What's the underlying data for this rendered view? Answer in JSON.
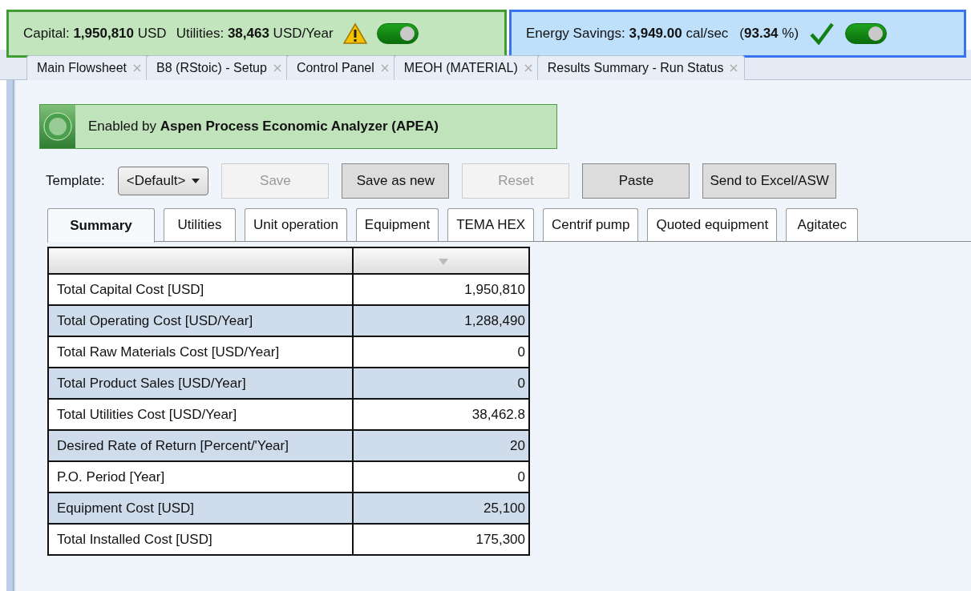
{
  "status_panels": [
    {
      "kind": "cost",
      "texts": [
        "Capital: **1,950,810** USD",
        "Utilities: **38,463** USD/Year"
      ],
      "toggle_on": true
    },
    {
      "kind": "energy",
      "texts": [
        "Energy Savings: **3,949.00** cal/sec",
        "(**93.34** %)"
      ],
      "toggle_on": true
    }
  ],
  "document_tabs": [
    {
      "label": "Main Flowsheet"
    },
    {
      "label": "B8 (RStoic) - Setup"
    },
    {
      "label": "Control Panel"
    },
    {
      "label": "MEOH (MATERIAL)"
    },
    {
      "label": "Results Summary - Run Status"
    }
  ],
  "banner": {
    "text": "Enabled by **Aspen Process Economic Analyzer (APEA)**"
  },
  "template": {
    "label": "Template:",
    "value": "<Default>"
  },
  "buttons": [
    {
      "label": "Save",
      "disabled": true
    },
    {
      "label": "Save as new",
      "disabled": false
    },
    {
      "label": "Reset",
      "disabled": true
    },
    {
      "label": "Paste",
      "disabled": false
    },
    {
      "label": "Send to Excel/ASW",
      "disabled": false
    }
  ],
  "tabs": [
    {
      "label": "Summary",
      "selected": true
    },
    {
      "label": "Utilities",
      "selected": false
    },
    {
      "label": "Unit operation",
      "selected": false
    },
    {
      "label": "Equipment",
      "selected": false
    },
    {
      "label": "TEMA HEX",
      "selected": false
    },
    {
      "label": "Centrif pump",
      "selected": false
    },
    {
      "label": "Quoted equipment",
      "selected": false
    },
    {
      "label": "Agitatec",
      "selected": false
    }
  ],
  "table": {
    "rows": [
      {
        "name": "Total Capital Cost [USD]",
        "value": "1,950,810"
      },
      {
        "name": "Total Operating Cost [USD/Year]",
        "value": "1,288,490"
      },
      {
        "name": "Total Raw Materials Cost [USD/Year]",
        "value": "0"
      },
      {
        "name": "Total Product Sales [USD/Year]",
        "value": "0"
      },
      {
        "name": "Total Utilities Cost [USD/Year]",
        "value": "38,462.8"
      },
      {
        "name": "Desired Rate of Return [Percent/'Year]",
        "value": "20"
      },
      {
        "name": "P.O. Period [Year]",
        "value": "0"
      },
      {
        "name": "Equipment Cost [USD]",
        "value": "25,100"
      },
      {
        "name": "Total Installed Cost [USD]",
        "value": "175,300"
      }
    ]
  }
}
